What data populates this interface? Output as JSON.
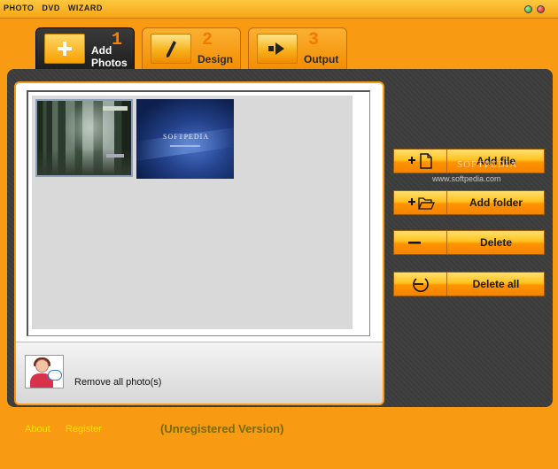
{
  "window": {
    "title": "PHOTO DVD WIZARD"
  },
  "tabs": [
    {
      "number": "1",
      "label_line1": "Add",
      "label_line2": "Photos",
      "active": true,
      "icon": "plus-icon"
    },
    {
      "number": "2",
      "label": "Design",
      "active": false,
      "icon": "pen-icon"
    },
    {
      "number": "3",
      "label": "Output",
      "active": false,
      "icon": "arrow-right-icon"
    }
  ],
  "photos": {
    "items": [
      {
        "name": "forest-photo"
      },
      {
        "name": "softpedia-photo",
        "overlay_text": "SOFTPEDIA"
      }
    ]
  },
  "bottom_bar": {
    "remove_all_label": "Remove all photo(s)"
  },
  "actions": {
    "add_file": "Add file",
    "add_folder": "Add folder",
    "delete": "Delete",
    "delete_all": "Delete all"
  },
  "watermark": {
    "text": "SOFTPEDIA",
    "url": "www.softpedia.com"
  },
  "footer": {
    "about": "About",
    "register": "Register",
    "status": "(Unregistered Version)"
  },
  "colors": {
    "background": "#f89a12",
    "panel": "#3b3b3b",
    "link": "#ffe000",
    "status": "#7a6a00"
  }
}
